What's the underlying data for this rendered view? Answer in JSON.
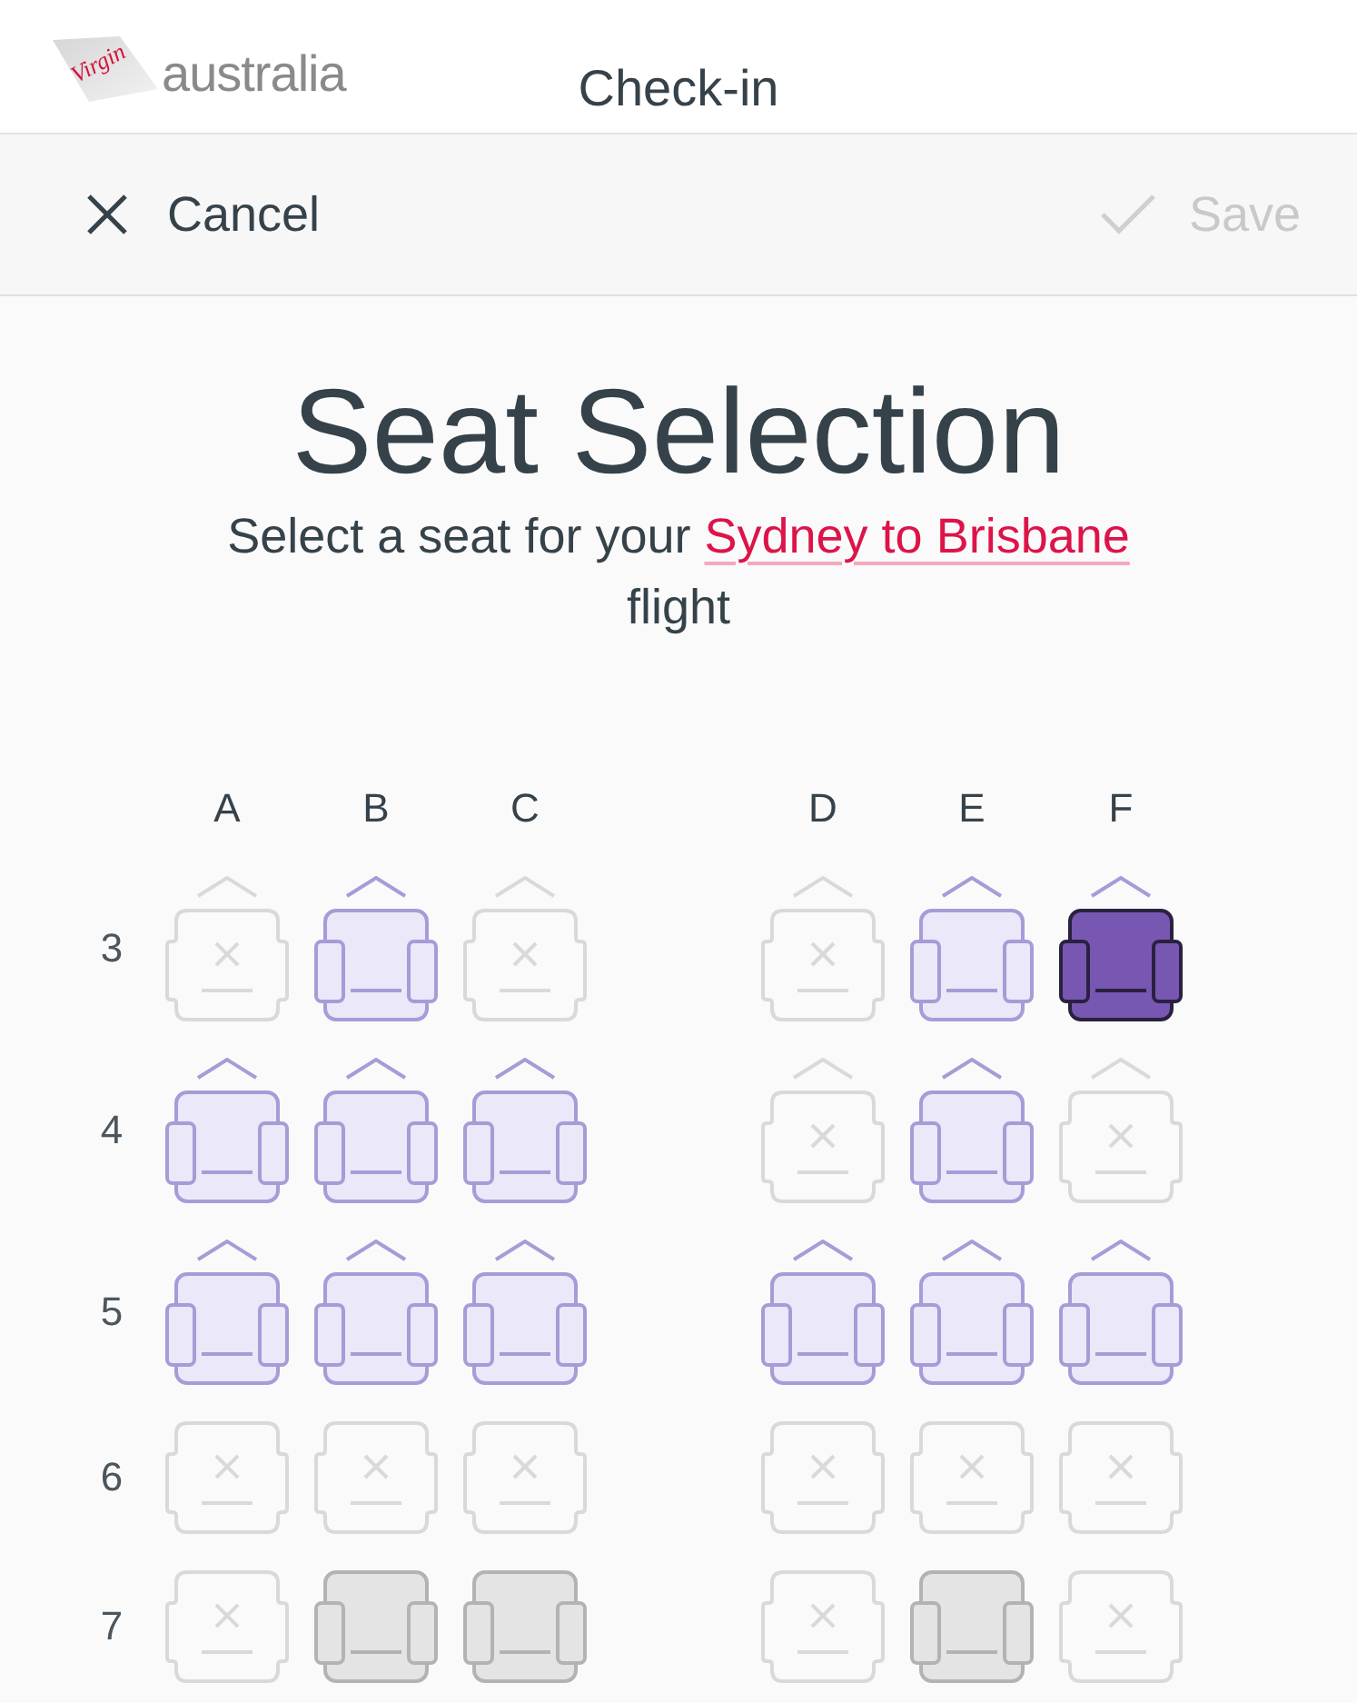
{
  "header": {
    "logo": {
      "script": "Virgin",
      "wordmark": "australia"
    },
    "title": "Check-in"
  },
  "toolbar": {
    "cancel": {
      "label": "Cancel"
    },
    "save": {
      "label": "Save",
      "disabled": true
    }
  },
  "title": "Seat Selection",
  "subtitle": {
    "before": "Select a seat for your",
    "link": "Sydney to Brisbane",
    "after": "flight"
  },
  "seat_map": {
    "columns": {
      "left": [
        "A",
        "B",
        "C"
      ],
      "right": [
        "D",
        "E",
        "F"
      ]
    },
    "rows": [
      {
        "label": "3",
        "chevrons": true,
        "left": [
          {
            "kind": "taken",
            "selected": false
          },
          {
            "kind": "available",
            "selected": false
          },
          {
            "kind": "taken",
            "selected": false
          }
        ],
        "right": [
          {
            "kind": "taken",
            "selected": false
          },
          {
            "kind": "available",
            "selected": false
          },
          {
            "kind": "available",
            "selected": true
          }
        ]
      },
      {
        "label": "4",
        "chevrons": true,
        "left": [
          {
            "kind": "available",
            "selected": false
          },
          {
            "kind": "available",
            "selected": false
          },
          {
            "kind": "available",
            "selected": false
          }
        ],
        "right": [
          {
            "kind": "taken",
            "selected": false
          },
          {
            "kind": "available",
            "selected": false
          },
          {
            "kind": "taken",
            "selected": false
          }
        ]
      },
      {
        "label": "5",
        "chevrons": true,
        "left": [
          {
            "kind": "available",
            "selected": false
          },
          {
            "kind": "available",
            "selected": false
          },
          {
            "kind": "available",
            "selected": false
          }
        ],
        "right": [
          {
            "kind": "available",
            "selected": false
          },
          {
            "kind": "available",
            "selected": false
          },
          {
            "kind": "available",
            "selected": false
          }
        ]
      },
      {
        "label": "6",
        "chevrons": false,
        "left": [
          {
            "kind": "taken",
            "selected": false
          },
          {
            "kind": "taken",
            "selected": false
          },
          {
            "kind": "taken",
            "selected": false
          }
        ],
        "right": [
          {
            "kind": "taken",
            "selected": false
          },
          {
            "kind": "taken",
            "selected": false
          },
          {
            "kind": "taken",
            "selected": false
          }
        ]
      },
      {
        "label": "7",
        "chevrons": false,
        "left": [
          {
            "kind": "taken",
            "selected": false
          },
          {
            "kind": "blocked",
            "selected": false
          },
          {
            "kind": "blocked",
            "selected": false
          }
        ],
        "right": [
          {
            "kind": "taken",
            "selected": false
          },
          {
            "kind": "blocked",
            "selected": false
          },
          {
            "kind": "taken",
            "selected": false
          }
        ]
      }
    ]
  }
}
